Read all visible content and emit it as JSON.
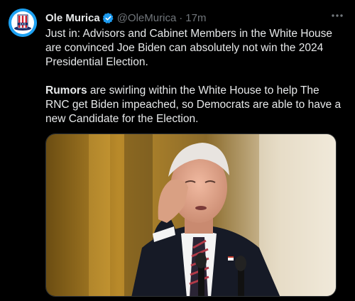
{
  "author": {
    "name": "Ole Murica",
    "handle": "@OleMurica",
    "separator": "·",
    "time": "17m"
  },
  "tweet": {
    "para1": "Just in: Advisors and Cabinet Members in the White House are convinced Joe Biden can absolutely not win the 2024 Presidential Election.",
    "para2_bold": "Rumors",
    "para2_rest": " are swirling within the White House to help The RNC get Biden impeached, so Democrats are able to have a new Candidate for the Election."
  },
  "icons": {
    "avatar": "uncle-sam-hat-icon",
    "verified": "verified-badge-icon",
    "more": "more-options-icon"
  },
  "colors": {
    "background": "#000000",
    "text": "#e7e9ea",
    "secondary": "#71767b",
    "verified": "#1d9bf0",
    "avatar_bg": "#1da1f2"
  }
}
